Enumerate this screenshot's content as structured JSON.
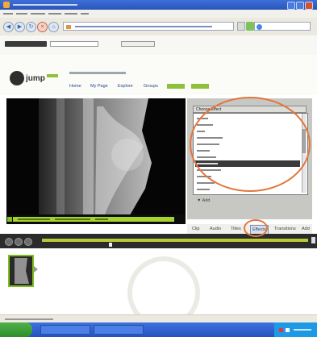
{
  "colors": {
    "highlight_ring": "#e2773c",
    "progress_green": "#a6d12e",
    "timeline_olive": "#b9c83a",
    "taskbar_blue": "#2452c0"
  },
  "effects_panel": {
    "header": "Choose Effect",
    "items": [
      "",
      "",
      "",
      "",
      "",
      "",
      "",
      "",
      "",
      "",
      "",
      ""
    ],
    "selected_index": 7,
    "add_label": "Add"
  },
  "tabs": {
    "items": [
      {
        "label": "Clip"
      },
      {
        "label": "Audio"
      },
      {
        "label": "Titles"
      },
      {
        "label": "Effects"
      },
      {
        "label": "Transitions"
      },
      {
        "label": "Add"
      }
    ],
    "active_index": 3
  },
  "header_nav": {
    "items": [
      "Home",
      "My Page",
      "Explore",
      "Groups",
      "",
      ""
    ]
  },
  "logo": {
    "text": "jump"
  },
  "icons": [
    "back-icon",
    "forward-icon",
    "reload-icon",
    "stop-icon",
    "home-icon",
    "page-icon",
    "search-icon",
    "play-icon",
    "stop-icon",
    "volume-icon",
    "scissors-icon"
  ],
  "timeline": {
    "playhead_fraction": 0.25
  }
}
